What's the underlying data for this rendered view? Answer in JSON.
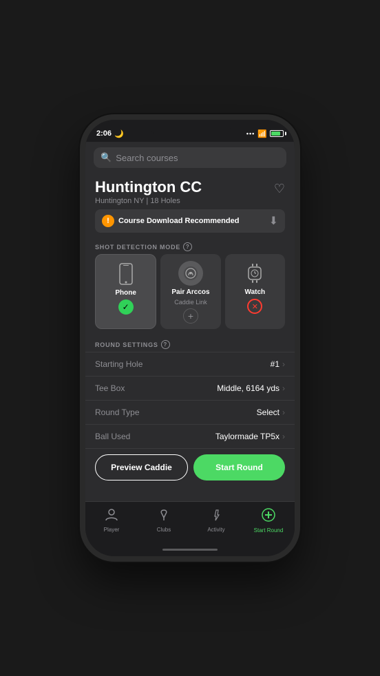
{
  "status": {
    "time": "2:06",
    "moon": true
  },
  "search": {
    "placeholder": "Search courses"
  },
  "course": {
    "name": "Huntington CC",
    "location": "Huntington NY | 18 Holes",
    "download_banner": "Course Download Recommended"
  },
  "shot_detection": {
    "section_label": "SHOT DETECTION MODE",
    "cards": [
      {
        "id": "phone",
        "label": "Phone",
        "sublabel": "",
        "status": "checked"
      },
      {
        "id": "arccos",
        "label": "Pair Arccos",
        "sublabel": "Caddie Link",
        "status": "plus"
      },
      {
        "id": "watch",
        "label": "Watch",
        "sublabel": "",
        "status": "error"
      }
    ]
  },
  "round_settings": {
    "section_label": "ROUND SETTINGS",
    "rows": [
      {
        "key": "Starting Hole",
        "value": "#1"
      },
      {
        "key": "Tee Box",
        "value": "Middle, 6164 yds"
      },
      {
        "key": "Round Type",
        "value": "Select"
      },
      {
        "key": "Ball Used",
        "value": "Taylormade TP5x"
      }
    ]
  },
  "buttons": {
    "preview": "Preview Caddie",
    "start": "Start Round"
  },
  "tabs": [
    {
      "id": "player",
      "label": "Player",
      "active": false
    },
    {
      "id": "clubs",
      "label": "Clubs",
      "active": false
    },
    {
      "id": "activity",
      "label": "Activity",
      "active": false
    },
    {
      "id": "start-round",
      "label": "Start Round",
      "active": true
    }
  ]
}
